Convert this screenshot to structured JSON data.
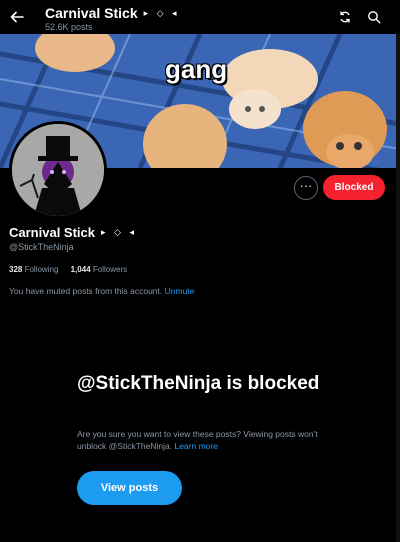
{
  "header": {
    "title": "Carnival Stick",
    "title_glyphs": "▸ ◇ ◂",
    "posts_count": "52.6K posts",
    "icons": [
      "back-arrow-icon",
      "refresh-icon",
      "search-icon"
    ]
  },
  "banner": {
    "overlay_text": "gang"
  },
  "profile": {
    "display_name": "Carnival Stick",
    "name_glyphs": "▸ ◇ ◂",
    "handle": "@StickTheNinja",
    "following_count": "328",
    "following_label": "Following",
    "followers_count": "1,044",
    "followers_label": "Followers",
    "muted_notice": "You have muted posts from this account.",
    "unmute_label": "Unmute",
    "more_label": "···",
    "blocked_label": "Blocked"
  },
  "blocked_panel": {
    "heading": "@StickTheNinja is blocked",
    "body": "Are you sure you want to view these posts? Viewing posts won’t unblock @StickTheNinja.",
    "learn_more": "Learn more",
    "button_label": "View posts"
  },
  "colors": {
    "background": "#000000",
    "accent_blue": "#1d9bf0",
    "blocked_red": "#f4212e",
    "muted_text": "#8b98a5"
  }
}
